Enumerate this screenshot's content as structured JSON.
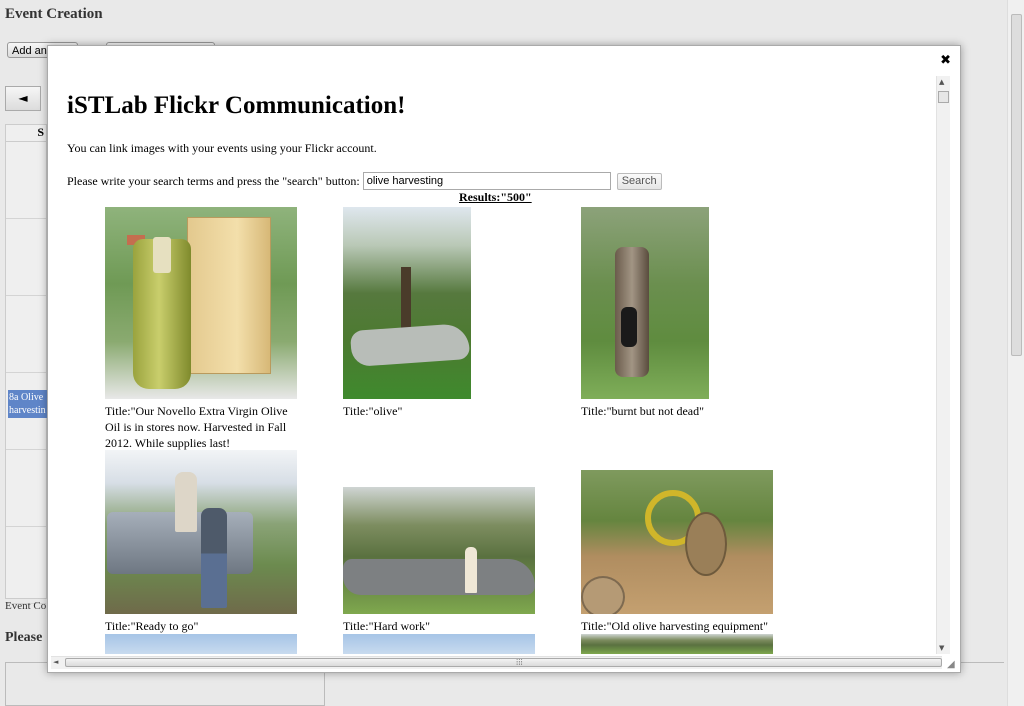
{
  "background": {
    "page_title": "Event Creation",
    "add_button_label": "Add an",
    "second_button_label": "",
    "nav_prev": "◄",
    "grid_header": "S",
    "event_text": "8a Olive harvestin",
    "event_label": "Event Co",
    "heading": "Please"
  },
  "dialog": {
    "close": "✖",
    "title": "iSTLab Flickr Communication!",
    "intro": "You can link images with your events using your Flickr account.",
    "search_prompt": "Please write your search terms and press the \"search\" button:",
    "search_value": "olive harvesting",
    "search_button": "Search",
    "results_label": "Results:\"500\""
  },
  "photos": [
    {
      "caption": "Title:\"Our Novello Extra Virgin Olive Oil is in stores now. Harvested in Fall 2012. While supplies last! http://bit.ly/YoTaQE\""
    },
    {
      "caption": "Title:\"olive\""
    },
    {
      "caption": "Title:\"burnt but not dead\""
    },
    {
      "caption": "Title:\"Ready to go\""
    },
    {
      "caption": "Title:\"Hard work\""
    },
    {
      "caption": "Title:\"Old olive harvesting equipment\""
    }
  ],
  "icons": {
    "close": "close-icon",
    "scroll_up": "▲",
    "scroll_down": "▼",
    "scroll_left": "◄",
    "grip": "⁞⁞⁞",
    "resize": "◢"
  }
}
